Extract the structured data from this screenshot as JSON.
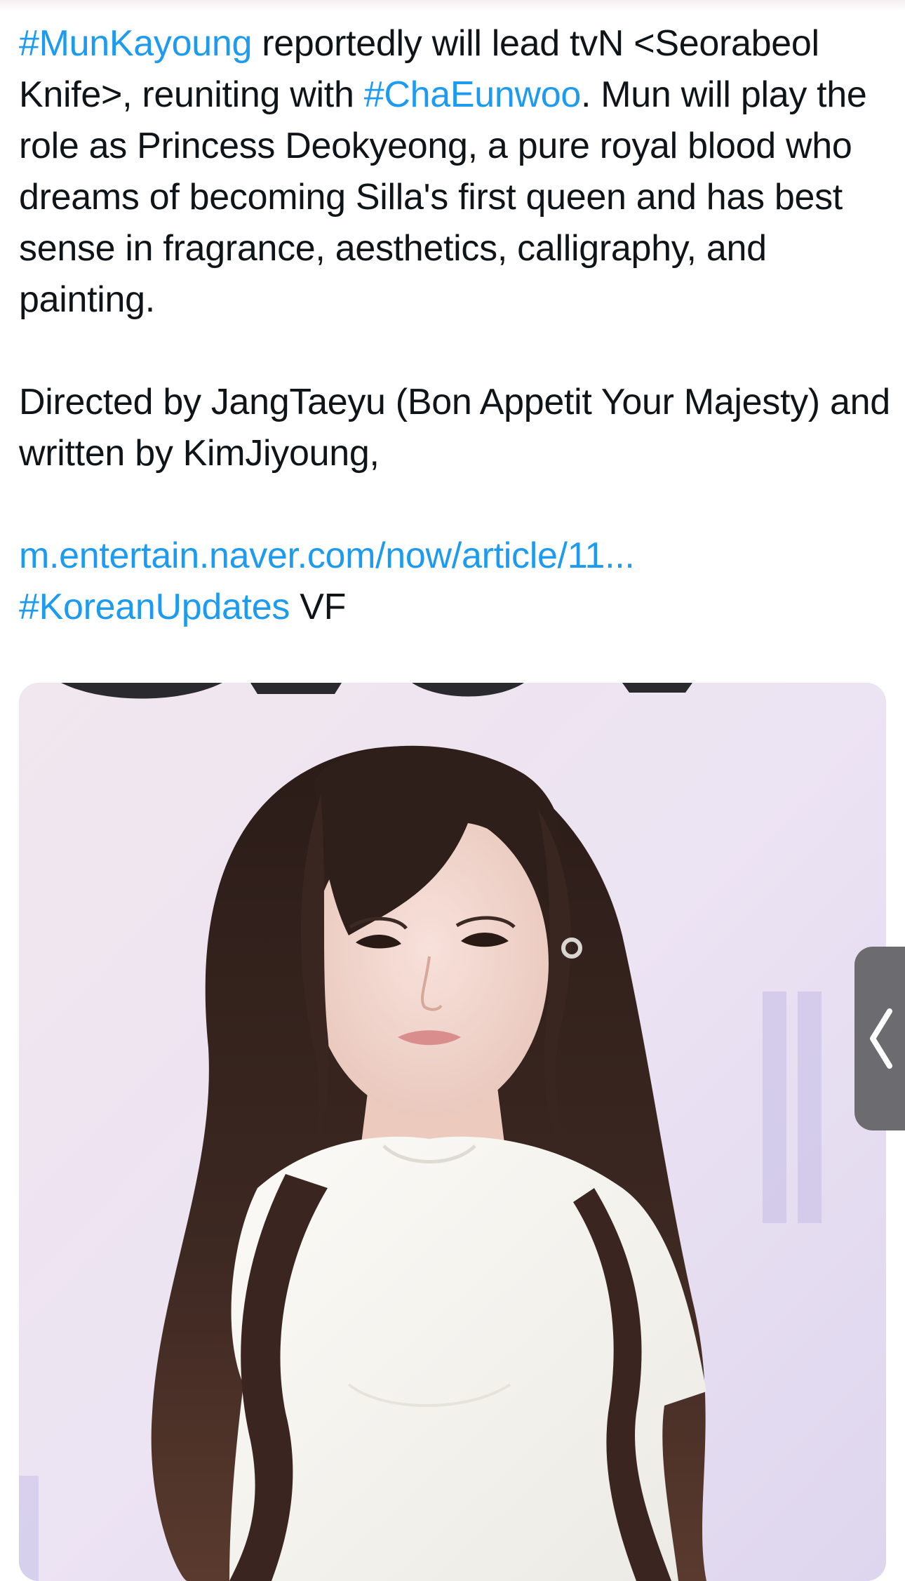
{
  "tweet": {
    "p1": {
      "tag1": "#MunKayoung",
      "t1": " reportedly will lead tvN <Seorabeol Knife>, reuniting with ",
      "tag2": "#ChaEunwoo",
      "t2": ". Mun will play the role as Princess Deokyeong, a pure royal blood who dreams of becoming Silla's first queen and has best sense in fragrance, aesthetics, calligraphy, and painting."
    },
    "p2": "Directed by JangTaeyu (Bon Appetit Your Majesty) and written by KimJiyoung,",
    "p3": {
      "url": "m.entertain.naver.com/now/article/11...",
      "tag3": "#KoreanUpdates",
      "t3": " VF"
    }
  },
  "media": {
    "description_icon": "photo-of-actress-in-white-dress"
  },
  "side_tab": {
    "icon": "chevron-left-icon"
  },
  "colors": {
    "link": "#1d9bf0",
    "text": "#0f1419",
    "side_tab": "#6b6b70"
  }
}
